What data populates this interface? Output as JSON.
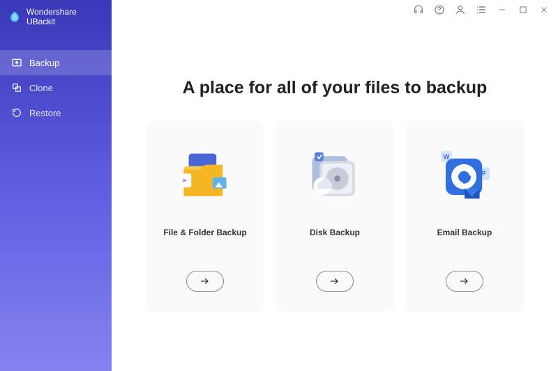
{
  "brand": {
    "name": "Wondershare UBackit"
  },
  "sidebar": {
    "items": [
      {
        "label": "Backup",
        "icon": "backup-icon",
        "active": true
      },
      {
        "label": "Clone",
        "icon": "clone-icon",
        "active": false
      },
      {
        "label": "Restore",
        "icon": "restore-icon",
        "active": false
      }
    ]
  },
  "topbar": {
    "icons": [
      "headset-icon",
      "help-icon",
      "user-icon",
      "list-icon",
      "minimize-icon",
      "maximize-icon",
      "close-icon"
    ]
  },
  "main": {
    "title": "A place for all of your files to backup",
    "cards": [
      {
        "label": "File & Folder Backup",
        "icon": "folder-icon"
      },
      {
        "label": "Disk Backup",
        "icon": "disk-icon"
      },
      {
        "label": "Email Backup",
        "icon": "email-icon"
      }
    ]
  }
}
